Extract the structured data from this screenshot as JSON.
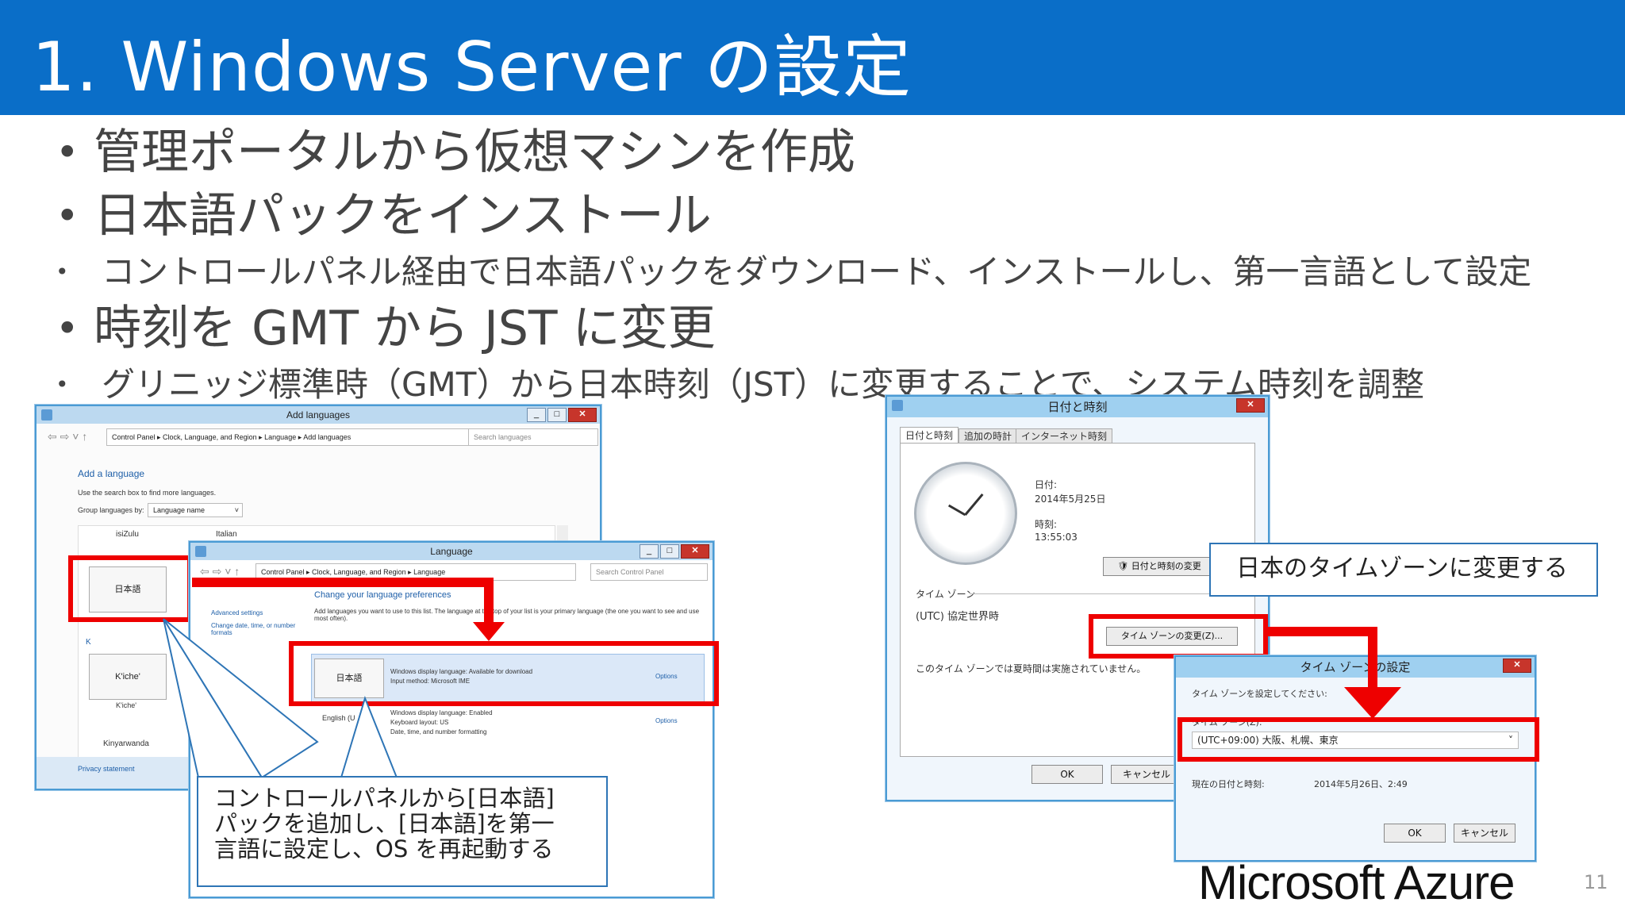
{
  "slide": {
    "title": "1. Windows Server の設定",
    "page_number": "11",
    "logo_text": "Microsoft Azure"
  },
  "bullets": [
    {
      "level": 1,
      "text": "管理ポータルから仮想マシンを作成"
    },
    {
      "level": 1,
      "text": "日本語パックをインストール"
    },
    {
      "level": 2,
      "text": "コントロールパネル経由で日本語パックをダウンロード、インストールし、第一言語として設定"
    },
    {
      "level": 1,
      "text": "時刻を GMT から JST に変更"
    },
    {
      "level": 2,
      "text": "グリニッジ標準時（GMT）から日本時刻（JST）に変更することで、システム時刻を調整"
    }
  ],
  "add_languages_window": {
    "title": "Add languages",
    "address": "Control Panel ▸ Clock, Language, and Region ▸ Language ▸ Add languages",
    "search_placeholder": "Search languages",
    "heading": "Add a language",
    "hint": "Use the search box to find more languages.",
    "group_label": "Group languages by:",
    "group_value": "Language name",
    "lang_top_left": "isiZulu",
    "lang_top_right": "Italian",
    "tile_japanese": "日本語",
    "letter_k": "K",
    "tile_kiche": "K'iche'",
    "kiche_caption": "K'iche'",
    "lang_kinya": "Kinyarwanda",
    "privacy": "Privacy statement"
  },
  "language_window": {
    "title": "Language",
    "address": "Control Panel ▸ Clock, Language, and Region ▸ Language",
    "search_placeholder": "Search Control Panel",
    "heading": "Change your language preferences",
    "side_link_1": "Advanced settings",
    "side_link_2": "Change date, time, or number formats",
    "description": "Add languages you want to use to this list. The language at the top of your list is your primary language (the one you want to see and use most often).",
    "row1_name": "日本語",
    "row1_line1": "Windows display language: Available for download",
    "row1_line2": "Input method: Microsoft IME",
    "row1_options": "Options",
    "row2_name": "English (U",
    "row2_line1": "Windows display language: Enabled",
    "row2_line2": "Keyboard layout: US",
    "row2_line3": "Date, time, and number formatting",
    "row2_options": "Options"
  },
  "callout_language": {
    "text": "コントロールパネルから[日本語]パックを追加し、[日本語]を第一言語に設定し、OS を再起動する"
  },
  "datetime_window": {
    "title": "日付と時刻",
    "tabs": [
      "日付と時刻",
      "追加の時計",
      "インターネット時刻"
    ],
    "date_label": "日付:",
    "date_value": "2014年5月25日",
    "time_label": "時刻:",
    "time_value": "13:55:03",
    "change_datetime_button": "日付と時刻の変更",
    "timezone_section": "タイム ゾーン",
    "timezone_value": "(UTC) 協定世界時",
    "change_tz_button": "タイム ゾーンの変更(Z)...",
    "dst_note": "このタイム ゾーンでは夏時間は実施されていません。",
    "ok": "OK",
    "cancel": "キャンセル"
  },
  "callout_timezone": {
    "text": "日本のタイムゾーンに変更する"
  },
  "timezone_window": {
    "title": "タイム ゾーンの設定",
    "prompt": "タイム ゾーンを設定してください:",
    "field_label": "タイム ゾーン(Z):",
    "selected": "(UTC+09:00) 大阪、札幌、東京",
    "current_label": "現在の日付と時刻:",
    "current_value": "2014年5月26日、2:49",
    "ok": "OK",
    "cancel": "キャンセル"
  },
  "colors": {
    "header_bg": "#0a6ec8",
    "highlight": "#ee0000",
    "callout_border": "#2e75b6"
  }
}
